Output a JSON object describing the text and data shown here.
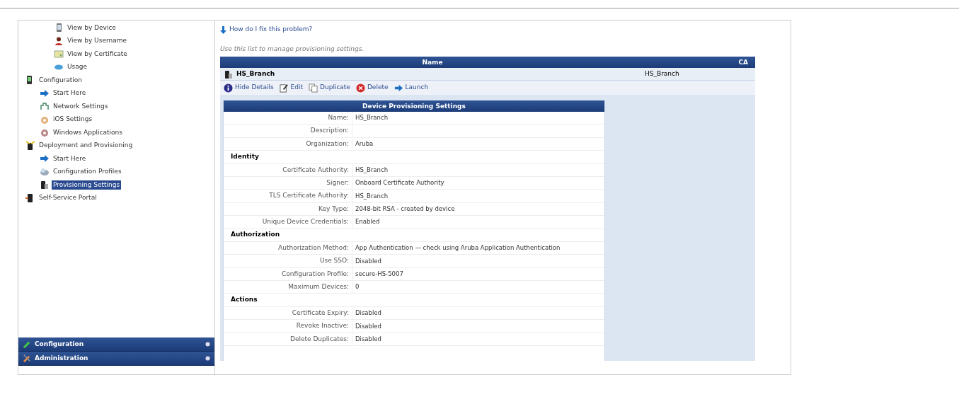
{
  "sidebar": {
    "tree": [
      {
        "children": [
          {
            "label": "View by Device",
            "kind": "device",
            "selected": false
          },
          {
            "label": "View by Username",
            "kind": "user",
            "selected": false
          },
          {
            "label": "View by Certificate",
            "kind": "certificate",
            "selected": false
          },
          {
            "label": "Usage",
            "kind": "usage",
            "selected": false
          }
        ]
      },
      {
        "label": "Configuration",
        "kind": "config",
        "selected": false,
        "children": [
          {
            "label": "Start Here",
            "kind": "arrow",
            "selected": false
          },
          {
            "label": "Network Settings",
            "kind": "network",
            "selected": false
          },
          {
            "label": "iOS Settings",
            "kind": "ios",
            "selected": false
          },
          {
            "label": "Windows Applications",
            "kind": "windows",
            "selected": false
          }
        ]
      },
      {
        "label": "Deployment and Provisioning",
        "kind": "deploy",
        "selected": false,
        "children": [
          {
            "label": "Start Here",
            "kind": "arrow",
            "selected": false
          },
          {
            "label": "Configuration Profiles",
            "kind": "profile",
            "selected": false
          },
          {
            "label": "Provisioning Settings",
            "kind": "provisioning",
            "selected": true
          }
        ]
      },
      {
        "label": "Self-Service Portal",
        "kind": "portal",
        "selected": false
      }
    ],
    "panels": [
      {
        "label": "Configuration",
        "kind": "config"
      },
      {
        "label": "Administration",
        "kind": "admin"
      }
    ]
  },
  "help_link": "How do I fix this problem?",
  "description": "Use this list to manage provisioning settings.",
  "table": {
    "columns": [
      "Name",
      "CA"
    ],
    "row": {
      "name": "HS_Branch",
      "ca": "HS_Branch"
    },
    "actions": [
      {
        "label": "Hide Details",
        "kind": "info"
      },
      {
        "label": "Edit",
        "kind": "edit"
      },
      {
        "label": "Duplicate",
        "kind": "duplicate"
      },
      {
        "label": "Delete",
        "kind": "delete"
      },
      {
        "label": "Launch",
        "kind": "launch"
      }
    ],
    "details": {
      "title": "Device Provisioning Settings",
      "rows": [
        {
          "kind": "field",
          "label": "Name:",
          "value": "HS_Branch"
        },
        {
          "kind": "field",
          "label": "Description:"
        },
        {
          "kind": "field",
          "label": "Organization:",
          "value": "Aruba"
        },
        {
          "kind": "section",
          "label": "Identity"
        },
        {
          "kind": "field",
          "label": "Certificate Authority:",
          "value": "HS_Branch"
        },
        {
          "kind": "field",
          "label": "Signer:",
          "value": "Onboard Certificate Authority"
        },
        {
          "kind": "field",
          "label": "TLS Certificate Authority:",
          "value": "HS_Branch"
        },
        {
          "kind": "field",
          "label": "Key Type:",
          "value": "2048-bit RSA - created by device"
        },
        {
          "kind": "field",
          "label": "Unique Device Credentials:",
          "value": "Enabled"
        },
        {
          "kind": "section",
          "label": "Authorization"
        },
        {
          "kind": "field",
          "label": "Authorization Method:",
          "value": "App Authentication — check using Aruba Application Authentication"
        },
        {
          "kind": "field",
          "label": "Use SSO:",
          "value": "Disabled"
        },
        {
          "kind": "field",
          "label": "Configuration Profile:",
          "value": "secure-HS-5007"
        },
        {
          "kind": "field",
          "label": "Maximum Devices:",
          "value": "0"
        },
        {
          "kind": "section",
          "label": "Actions"
        },
        {
          "kind": "field",
          "label": "Certificate Expiry:",
          "value": "Disabled"
        },
        {
          "kind": "field",
          "label": "Revoke Inactive:",
          "value": "Disabled"
        },
        {
          "kind": "field",
          "label": "Delete Duplicates:",
          "value": "Disabled"
        }
      ]
    }
  }
}
